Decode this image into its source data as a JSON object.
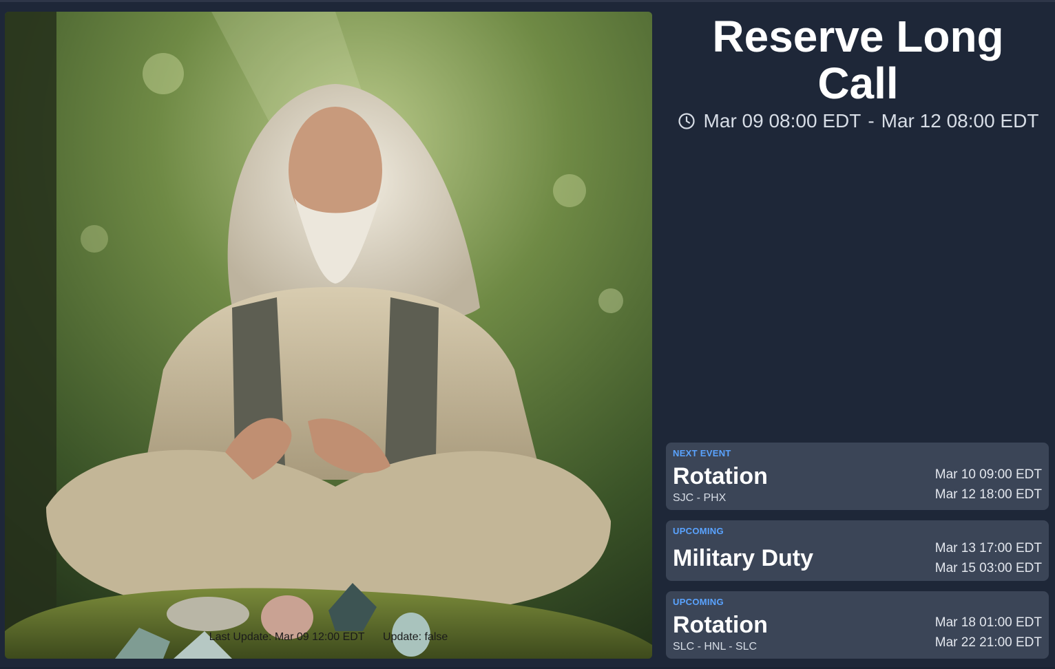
{
  "header": {
    "title_line1": "Reserve Long",
    "title_line2": "Call",
    "start": "Mar 09 08:00 EDT",
    "separator": "-",
    "end": "Mar 12 08:00 EDT",
    "icon": "clock-icon"
  },
  "photo": {
    "last_update": "Last Update: Mar 09 12:00 EDT",
    "update_status": "Update: false"
  },
  "events": [
    {
      "kicker": "NEXT EVENT",
      "name": "Rotation",
      "route": "SJC - PHX",
      "start": "Mar 10 09:00 EDT",
      "end": "Mar 12 18:00 EDT"
    },
    {
      "kicker": "UPCOMING",
      "name": "Military Duty",
      "route": "",
      "start": "Mar 13 17:00 EDT",
      "end": "Mar 15 03:00 EDT"
    },
    {
      "kicker": "UPCOMING",
      "name": "Rotation",
      "route": "SLC - HNL - SLC",
      "start": "Mar 18 01:00 EDT",
      "end": "Mar 22 21:00 EDT"
    }
  ],
  "colors": {
    "background": "#1e2738",
    "card": "#3b4557",
    "kicker": "#5aa3ff",
    "title": "#ffffff"
  }
}
